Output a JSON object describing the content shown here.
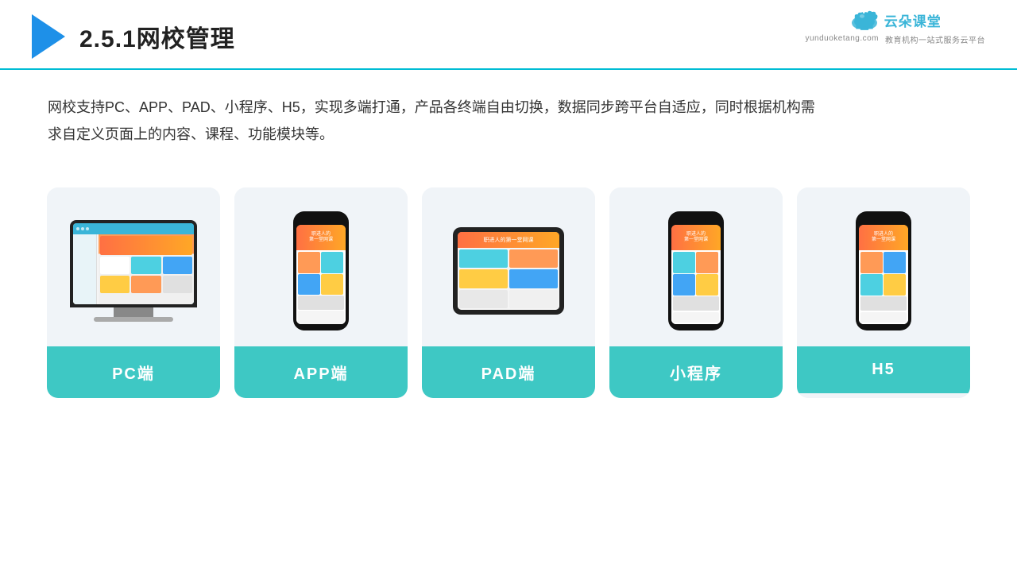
{
  "header": {
    "title": "2.5.1网校管理",
    "title_num": "2.5.1",
    "title_text": "网校管理",
    "divider_color": "#00bcd4"
  },
  "brand": {
    "name": "云朵课堂",
    "url": "yunduoketang.com",
    "slogan": "教育机构一站\n式服务云平台"
  },
  "description": {
    "text": "网校支持PC、APP、PAD、小程序、H5，实现多端打通，产品各终端自由切换，数据同步跨平台自适应，同时根据机构需求自定义页面上的内容、课程、功能模块等。"
  },
  "cards": [
    {
      "id": "pc",
      "label": "PC端",
      "type": "pc"
    },
    {
      "id": "app",
      "label": "APP端",
      "type": "phone"
    },
    {
      "id": "pad",
      "label": "PAD端",
      "type": "tablet"
    },
    {
      "id": "mini",
      "label": "小程序",
      "type": "phone"
    },
    {
      "id": "h5",
      "label": "H5",
      "type": "phone"
    }
  ]
}
